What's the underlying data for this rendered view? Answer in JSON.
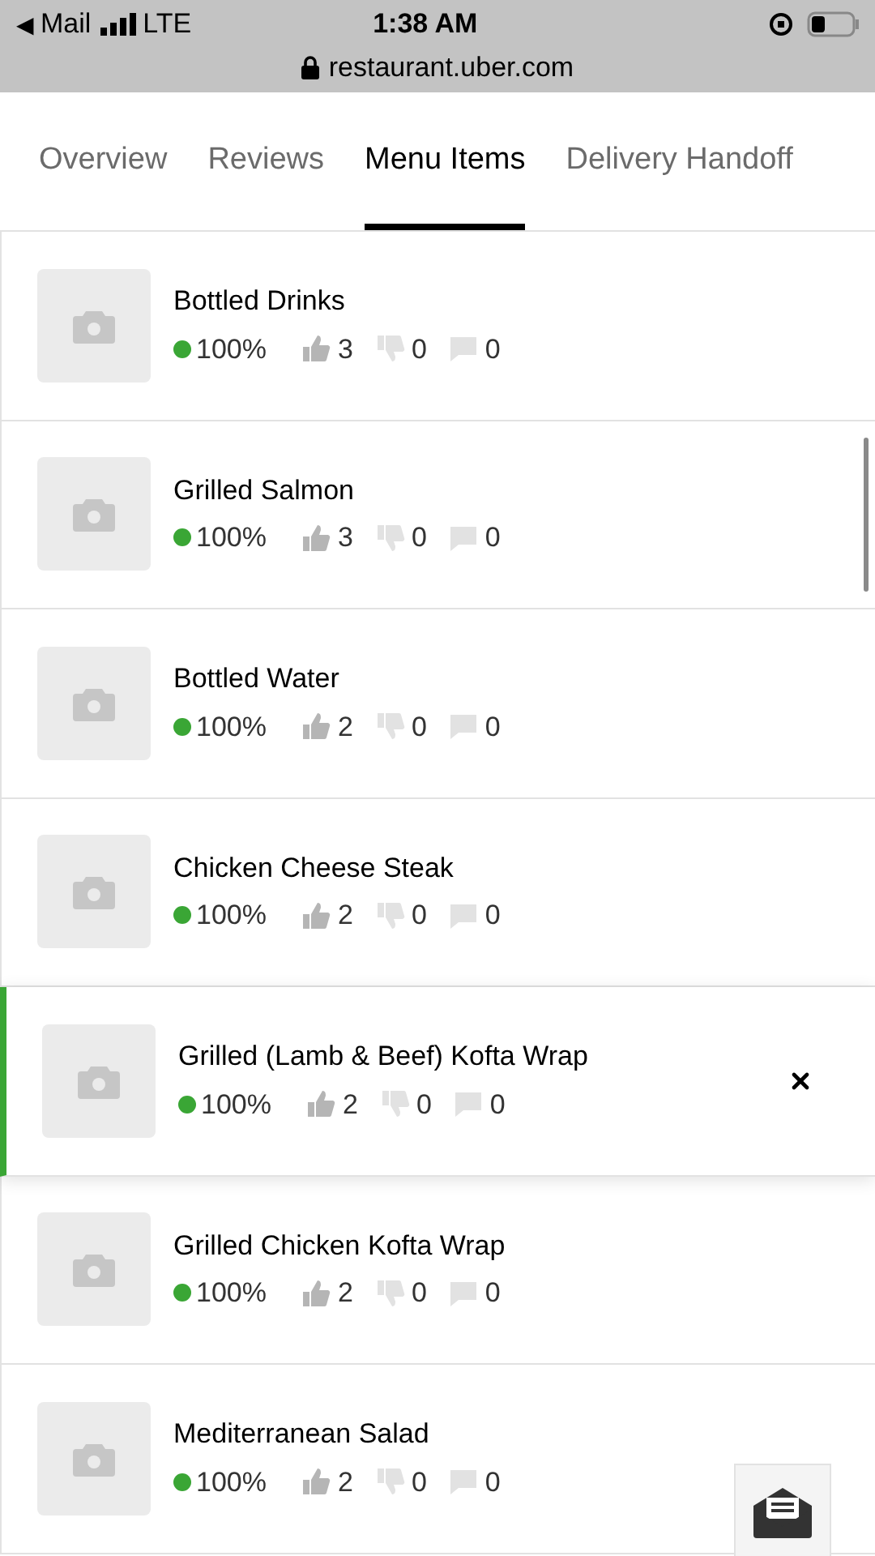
{
  "status_bar": {
    "back": "◀",
    "back_app": "Mail",
    "network": "LTE",
    "time": "1:38 AM",
    "url": "restaurant.uber.com"
  },
  "tabs": [
    {
      "label": "Overview",
      "selected": false
    },
    {
      "label": "Reviews",
      "selected": false
    },
    {
      "label": "Menu Items",
      "selected": true
    },
    {
      "label": "Delivery Handoff",
      "selected": false
    }
  ],
  "items": [
    {
      "name": "Bottled Drinks",
      "rating": "100%",
      "likes": "3",
      "dislikes": "0",
      "comments": "0",
      "selected": false
    },
    {
      "name": "Grilled Salmon",
      "rating": "100%",
      "likes": "3",
      "dislikes": "0",
      "comments": "0",
      "selected": false
    },
    {
      "name": "Bottled Water",
      "rating": "100%",
      "likes": "2",
      "dislikes": "0",
      "comments": "0",
      "selected": false
    },
    {
      "name": "Chicken Cheese Steak",
      "rating": "100%",
      "likes": "2",
      "dislikes": "0",
      "comments": "0",
      "selected": false
    },
    {
      "name": "Grilled (Lamb & Beef) Kofta Wrap",
      "rating": "100%",
      "likes": "2",
      "dislikes": "0",
      "comments": "0",
      "selected": true
    },
    {
      "name": "Grilled Chicken Kofta Wrap",
      "rating": "100%",
      "likes": "2",
      "dislikes": "0",
      "comments": "0",
      "selected": false
    },
    {
      "name": "Mediterranean Salad",
      "rating": "100%",
      "likes": "2",
      "dislikes": "0",
      "comments": "0",
      "selected": false
    }
  ]
}
